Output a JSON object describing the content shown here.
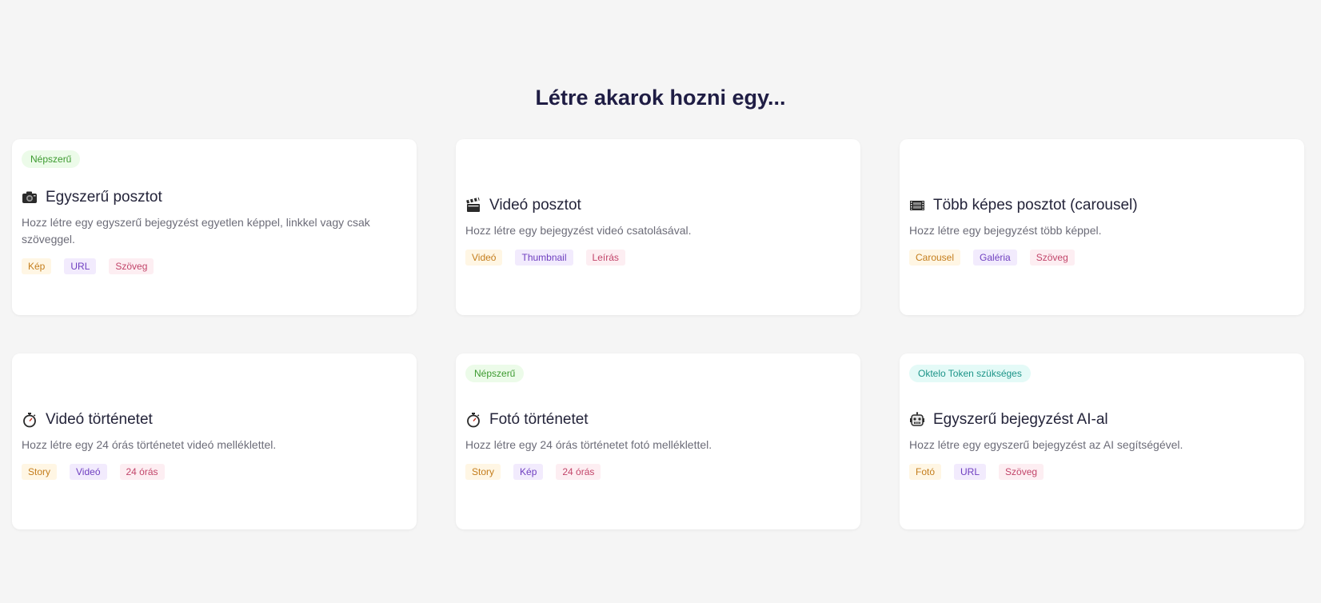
{
  "heading": "Létre akarok hozni egy...",
  "colors": {
    "background": "#f5f5f5",
    "card": "#ffffff",
    "heading": "#1f1d44",
    "badge_popular": "#3c9a2f",
    "badge_token": "#1c9488",
    "tag_orange": "#c47d1c",
    "tag_purple": "#6f3fc0",
    "tag_pink": "#c2456a"
  },
  "cards": [
    {
      "badge": "Népszerű",
      "icon": "camera-icon",
      "title": "Egyszerű posztot",
      "description": "Hozz létre egy egyszerű bejegyzést egyetlen képpel, linkkel vagy csak szöveggel.",
      "tags": [
        "Kép",
        "URL",
        "Szöveg"
      ]
    },
    {
      "badge": "",
      "icon": "clapperboard-icon",
      "title": "Videó posztot",
      "description": "Hozz létre egy bejegyzést videó csatolásával.",
      "tags": [
        "Videó",
        "Thumbnail",
        "Leírás"
      ]
    },
    {
      "badge": "",
      "icon": "film-frames-icon",
      "title": "Több képes posztot (carousel)",
      "description": "Hozz létre egy bejegyzést több képpel.",
      "tags": [
        "Carousel",
        "Galéria",
        "Szöveg"
      ]
    },
    {
      "badge": "",
      "icon": "stopwatch-icon",
      "title": "Videó történetet",
      "description": "Hozz létre egy 24 órás történetet videó melléklettel.",
      "tags": [
        "Story",
        "Videó",
        "24 órás"
      ]
    },
    {
      "badge": "Népszerű",
      "icon": "stopwatch-icon",
      "title": "Fotó történetet",
      "description": "Hozz létre egy 24 órás történetet fotó melléklettel.",
      "tags": [
        "Story",
        "Kép",
        "24 órás"
      ]
    },
    {
      "badge": "Oktelo Token szükséges",
      "icon": "robot-icon",
      "title": "Egyszerű bejegyzést AI-al",
      "description": "Hozz létre egy egyszerű bejegyzést az AI segítségével.",
      "tags": [
        "Fotó",
        "URL",
        "Szöveg"
      ]
    }
  ]
}
